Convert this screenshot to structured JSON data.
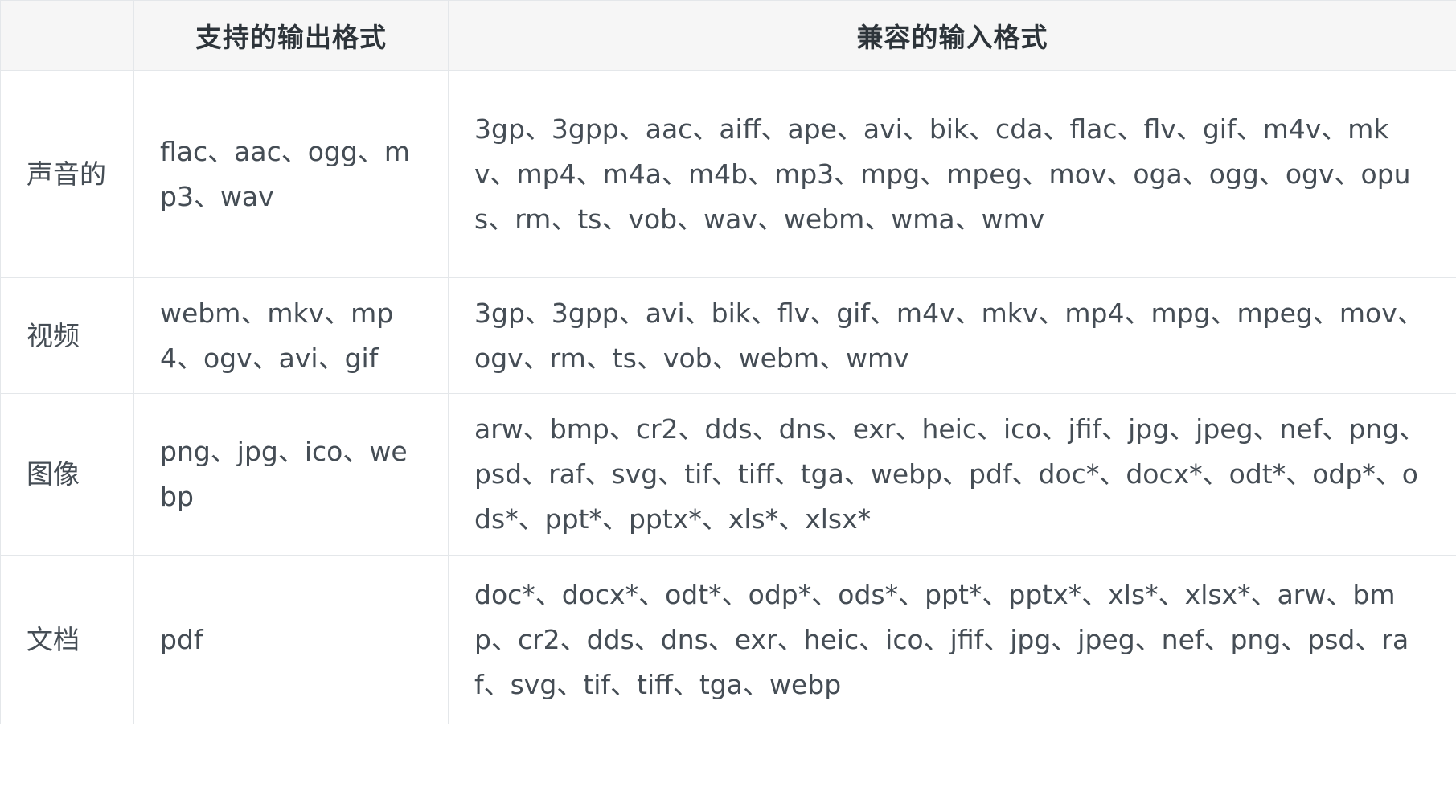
{
  "table": {
    "headers": [
      "",
      "支持的输出格式",
      "兼容的输入格式"
    ],
    "rows": [
      {
        "category": "声音的",
        "output": "flac、aac、ogg、mp3、wav",
        "input": "3gp、3gpp、aac、aiff、ape、avi、bik、cda、flac、flv、gif、m4v、mkv、mp4、m4a、m4b、mp3、mpg、mpeg、mov、oga、ogg、ogv、opus、rm、ts、vob、wav、webm、wma、wmv"
      },
      {
        "category": "视频",
        "output": "webm、mkv、mp4、ogv、avi、gif",
        "input": "3gp、3gpp、avi、bik、flv、gif、m4v、mkv、mp4、mpg、mpeg、mov、ogv、rm、ts、vob、webm、wmv"
      },
      {
        "category": "图像",
        "output": "png、jpg、ico、webp",
        "input": "arw、bmp、cr2、dds、dns、exr、heic、ico、jfif、jpg、jpeg、nef、png、psd、raf、svg、tif、tiff、tga、webp、pdf、doc*、docx*、odt*、odp*、ods*、ppt*、pptx*、xls*、xlsx*"
      },
      {
        "category": "文档",
        "output": "pdf",
        "input": "doc*、docx*、odt*、odp*、ods*、ppt*、pptx*、xls*、xlsx*、arw、bmp、cr2、dds、dns、exr、heic、ico、jfif、jpg、jpeg、nef、png、psd、raf、svg、tif、tiff、tga、webp"
      }
    ]
  }
}
